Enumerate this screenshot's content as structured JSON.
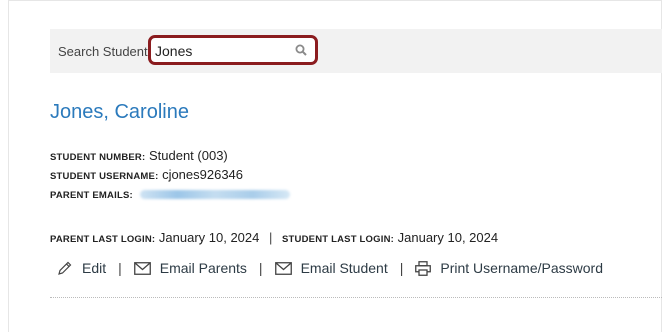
{
  "search": {
    "label": "Search Students",
    "value": "Jones",
    "icon": "search-icon"
  },
  "student": {
    "name": "Jones, Caroline",
    "number_label": "STUDENT NUMBER:",
    "number_value": "Student (003)",
    "username_label": "STUDENT USERNAME:",
    "username_value": "cjones926346",
    "parent_emails_label": "PARENT EMAILS:",
    "parent_login_label": "PARENT LAST LOGIN:",
    "parent_login_value": "January 10, 2024",
    "student_login_label": "STUDENT LAST LOGIN:",
    "student_login_value": "January 10, 2024",
    "separator": "|"
  },
  "actions": {
    "edit": "Edit",
    "email_parents": "Email Parents",
    "email_student": "Email Student",
    "print": "Print Username/Password",
    "separator": "|"
  },
  "colors": {
    "link": "#2b7abc",
    "highlight": "#8b1c1f"
  }
}
